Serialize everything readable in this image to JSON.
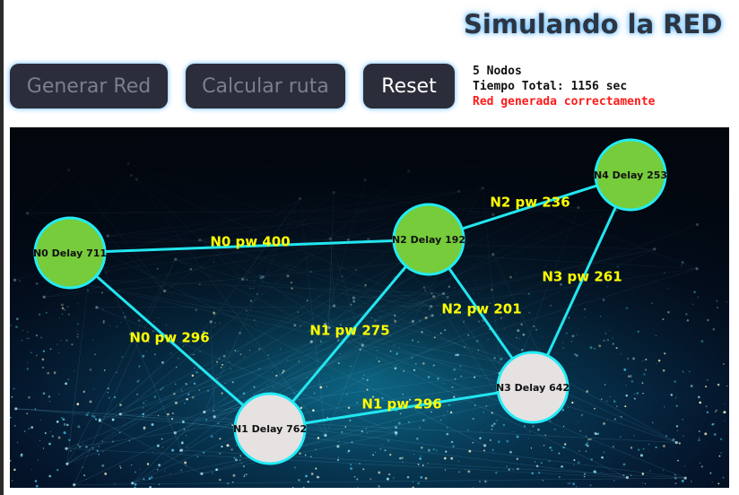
{
  "title": "Simulando la RED",
  "buttons": {
    "generar": "Generar Red",
    "calcular": "Calcular ruta",
    "reset": "Reset"
  },
  "status": {
    "nodos": "5 Nodos",
    "tiempo": "Tiempo Total: 1156 sec",
    "mensaje": "Red generada correctamente"
  },
  "colors": {
    "edge": "#22e6f0",
    "edge_label": "#ffff00",
    "node_green": "#76cc3b",
    "node_white": "#e6e2e2",
    "node_border": "#23ecf5",
    "message": "#ff1a1a"
  },
  "network": {
    "nodes": [
      {
        "id": "N0",
        "label": "N0 Delay 711",
        "state": "green"
      },
      {
        "id": "N1",
        "label": "N1 Delay 762",
        "state": "white"
      },
      {
        "id": "N2",
        "label": "N2 Delay 192",
        "state": "green"
      },
      {
        "id": "N3",
        "label": "N3 Delay 642",
        "state": "white"
      },
      {
        "id": "N4",
        "label": "N4 Delay 253",
        "state": "green"
      }
    ],
    "edges": [
      {
        "from": "N0",
        "to": "N2",
        "label": "N0 pw 400"
      },
      {
        "from": "N0",
        "to": "N1",
        "label": "N0 pw 296"
      },
      {
        "from": "N1",
        "to": "N2",
        "label": "N1 pw 275"
      },
      {
        "from": "N1",
        "to": "N3",
        "label": "N1 pw 296"
      },
      {
        "from": "N2",
        "to": "N3",
        "label": "N2 pw 201"
      },
      {
        "from": "N2",
        "to": "N4",
        "label": "N2 pw 236"
      },
      {
        "from": "N3",
        "to": "N4",
        "label": "N3 pw 261"
      }
    ]
  }
}
